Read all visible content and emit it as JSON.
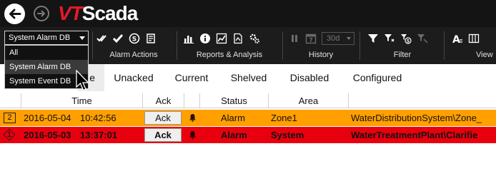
{
  "app": {
    "logo_prefix": "VT",
    "logo_suffix": "Scada"
  },
  "toolbar": {
    "db_select": {
      "value": "System Alarm DB"
    },
    "groups": [
      {
        "label": "Alarm Actions"
      },
      {
        "label": "Reports & Analysis"
      },
      {
        "label": "History"
      },
      {
        "label": "Filter"
      },
      {
        "label": "View"
      }
    ],
    "days_select": "30d",
    "calendar_day": "7"
  },
  "dropdown": {
    "options": [
      "All",
      "System Alarm DB",
      "System Event DB"
    ],
    "highlighted": "System Alarm DB"
  },
  "tabs": [
    {
      "label": "e",
      "active": true
    },
    {
      "label": "Unacked"
    },
    {
      "label": "Current"
    },
    {
      "label": "Shelved"
    },
    {
      "label": "Disabled"
    },
    {
      "label": "Configured"
    }
  ],
  "table": {
    "columns": [
      "Time",
      "Ack",
      "Status",
      "Area"
    ],
    "rows": [
      {
        "priority": "2",
        "date": "2016-05-04",
        "time": "10:42:56",
        "ack": "Ack",
        "status": "Alarm",
        "area": "Zone1",
        "path": "WaterDistributionSystem\\Zone_"
      },
      {
        "priority": "1",
        "date": "2016-05-03",
        "time": "13:37:01",
        "ack": "Ack",
        "status": "Alarm",
        "area": "System",
        "path": "WaterTreatmentPlant\\Clarifie"
      }
    ]
  },
  "colors": {
    "row_warning": "#ff9f00",
    "row_critical": "#e8000f",
    "brand_red": "#e8182a"
  }
}
